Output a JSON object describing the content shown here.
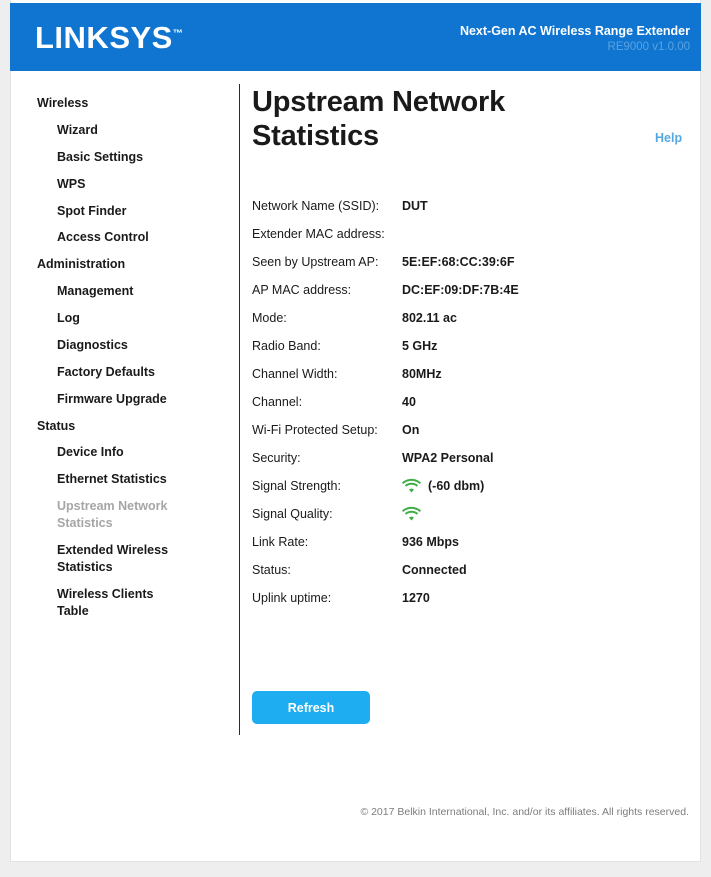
{
  "header": {
    "logo_text": "LINKSYS",
    "logo_tm": "™",
    "product_name": "Next-Gen AC Wireless Range Extender",
    "model_name": "RE9000 v1.0.00",
    "brand_color": "#0f75d1"
  },
  "sidebar": {
    "groups": [
      {
        "section": "Wireless",
        "items": [
          {
            "label": "Wizard",
            "active": false
          },
          {
            "label": "Basic Settings",
            "active": false
          },
          {
            "label": "WPS",
            "active": false
          },
          {
            "label": "Spot Finder",
            "active": false
          },
          {
            "label": "Access Control",
            "active": false
          }
        ]
      },
      {
        "section": "Administration",
        "items": [
          {
            "label": "Management",
            "active": false
          },
          {
            "label": "Log",
            "active": false
          },
          {
            "label": "Diagnostics",
            "active": false
          },
          {
            "label": "Factory Defaults",
            "active": false
          },
          {
            "label": "Firmware Upgrade",
            "active": false
          }
        ]
      },
      {
        "section": "Status",
        "items": [
          {
            "label": "Device Info",
            "active": false
          },
          {
            "label": "Ethernet Statistics",
            "active": false
          },
          {
            "label": "Upstream Network Statistics",
            "active": true
          },
          {
            "label": "Extended Wireless Statistics",
            "active": false
          },
          {
            "label": "Wireless Clients Table",
            "active": false
          }
        ]
      }
    ]
  },
  "main": {
    "title": "Upstream Network Statistics",
    "help_label": "Help",
    "help_color": "#56a8e0",
    "rows": [
      {
        "label": "Network Name (SSID):",
        "value": "DUT",
        "type": "text"
      },
      {
        "label": "Extender MAC address:",
        "value": "",
        "type": "text"
      },
      {
        "label": "Seen by Upstream AP:",
        "value": "5E:EF:68:CC:39:6F",
        "type": "text"
      },
      {
        "label": "AP MAC address:",
        "value": "DC:EF:09:DF:7B:4E",
        "type": "text"
      },
      {
        "label": "Mode:",
        "value": "802.11 ac",
        "type": "text"
      },
      {
        "label": "Radio Band:",
        "value": "5 GHz",
        "type": "text"
      },
      {
        "label": "Channel Width:",
        "value": "80MHz",
        "type": "text"
      },
      {
        "label": "Channel:",
        "value": "40",
        "type": "text"
      },
      {
        "label": "Wi-Fi Protected Setup:",
        "value": "On",
        "type": "text"
      },
      {
        "label": "Security:",
        "value": "WPA2 Personal",
        "type": "text"
      },
      {
        "label": "Signal Strength:",
        "value": "(-60 dbm)",
        "type": "signal",
        "icon": "wifi-icon",
        "icon_color": "#3fae49"
      },
      {
        "label": "Signal Quality:",
        "value": "",
        "type": "signal",
        "icon": "wifi-icon",
        "icon_color": "#3fae49"
      },
      {
        "label": "Link Rate:",
        "value": "936 Mbps",
        "type": "text"
      },
      {
        "label": "Status:",
        "value": "Connected",
        "type": "text"
      },
      {
        "label": "Uplink uptime:",
        "value": "1270",
        "type": "text"
      }
    ],
    "refresh_label": "Refresh",
    "refresh_color": "#1eadf0"
  },
  "footer": {
    "copyright": "© 2017 Belkin International, Inc. and/or its affiliates. All rights reserved."
  }
}
